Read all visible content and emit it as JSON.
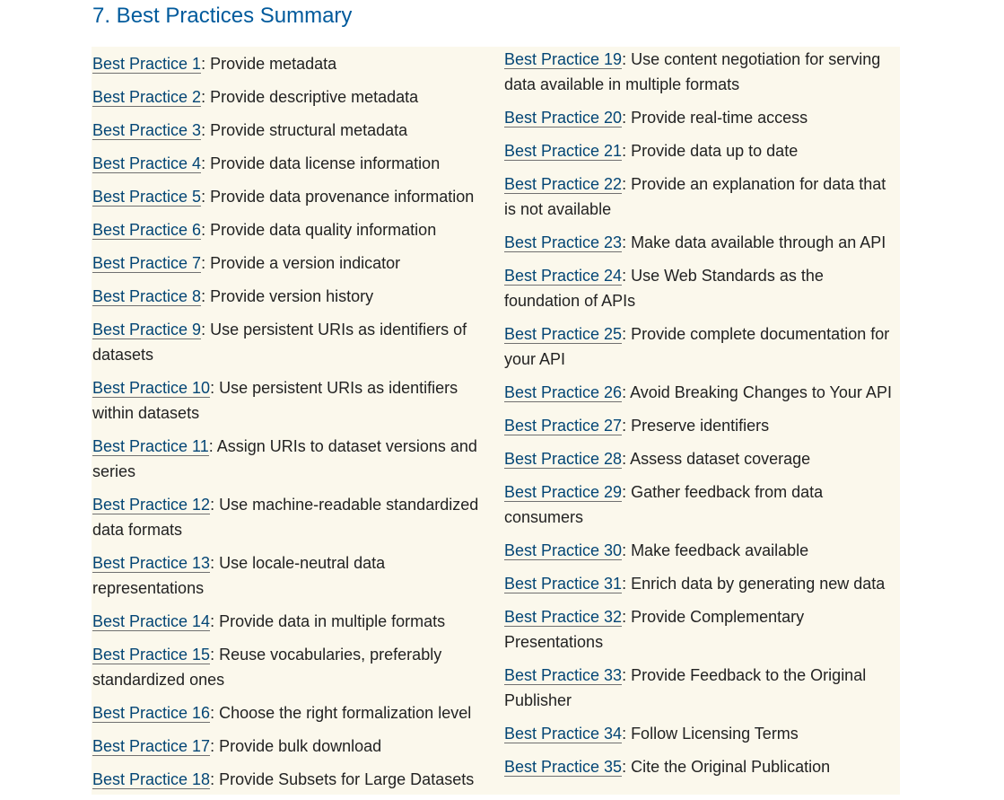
{
  "heading": "7. Best Practices Summary",
  "colors": {
    "heading": "#005a9c",
    "link": "#034575",
    "box_background": "#fbf8ec"
  },
  "left_column": [
    {
      "link": "Best Practice 1",
      "text": ": Provide metadata"
    },
    {
      "link": "Best Practice 2",
      "text": ": Provide descriptive metadata"
    },
    {
      "link": "Best Practice 3",
      "text": ": Provide structural metadata"
    },
    {
      "link": "Best Practice 4",
      "text": ": Provide data license information"
    },
    {
      "link": "Best Practice 5",
      "text": ": Provide data provenance information"
    },
    {
      "link": "Best Practice 6",
      "text": ": Provide data quality information"
    },
    {
      "link": "Best Practice 7",
      "text": ": Provide a version indicator"
    },
    {
      "link": "Best Practice 8",
      "text": ": Provide version history"
    },
    {
      "link": "Best Practice 9",
      "text": ": Use persistent URIs as identifiers of datasets"
    },
    {
      "link": "Best Practice 10",
      "text": ": Use persistent URIs as identifiers within datasets"
    },
    {
      "link": "Best Practice 11",
      "text": ": Assign URIs to dataset versions and series"
    },
    {
      "link": "Best Practice 12",
      "text": ": Use machine-readable standardized data formats"
    },
    {
      "link": "Best Practice 13",
      "text": ": Use locale-neutral data representations"
    },
    {
      "link": "Best Practice 14",
      "text": ": Provide data in multiple formats"
    },
    {
      "link": "Best Practice 15",
      "text": ": Reuse vocabularies, preferably standardized ones"
    },
    {
      "link": "Best Practice 16",
      "text": ": Choose the right formalization level"
    },
    {
      "link": "Best Practice 17",
      "text": ": Provide bulk download"
    },
    {
      "link": "Best Practice 18",
      "text": ": Provide Subsets for Large Datasets"
    }
  ],
  "right_column": [
    {
      "link": "Best Practice 19",
      "text": ": Use content negotiation for serving data available in multiple formats"
    },
    {
      "link": "Best Practice 20",
      "text": ": Provide real-time access"
    },
    {
      "link": "Best Practice 21",
      "text": ": Provide data up to date"
    },
    {
      "link": "Best Practice 22",
      "text": ": Provide an explanation for data that is not available"
    },
    {
      "link": "Best Practice 23",
      "text": ": Make data available through an API"
    },
    {
      "link": "Best Practice 24",
      "text": ": Use Web Standards as the foundation of APIs"
    },
    {
      "link": "Best Practice 25",
      "text": ": Provide complete documentation for your API"
    },
    {
      "link": "Best Practice 26",
      "text": ": Avoid Breaking Changes to Your API"
    },
    {
      "link": "Best Practice 27",
      "text": ": Preserve identifiers"
    },
    {
      "link": "Best Practice 28",
      "text": ": Assess dataset coverage"
    },
    {
      "link": "Best Practice 29",
      "text": ": Gather feedback from data consumers"
    },
    {
      "link": "Best Practice 30",
      "text": ": Make feedback available"
    },
    {
      "link": "Best Practice 31",
      "text": ": Enrich data by generating new data"
    },
    {
      "link": "Best Practice 32",
      "text": ": Provide Complementary Presentations"
    },
    {
      "link": "Best Practice 33",
      "text": ": Provide Feedback to the Original Publisher"
    },
    {
      "link": "Best Practice 34",
      "text": ": Follow Licensing Terms"
    },
    {
      "link": "Best Practice 35",
      "text": ": Cite the Original Publication"
    }
  ]
}
